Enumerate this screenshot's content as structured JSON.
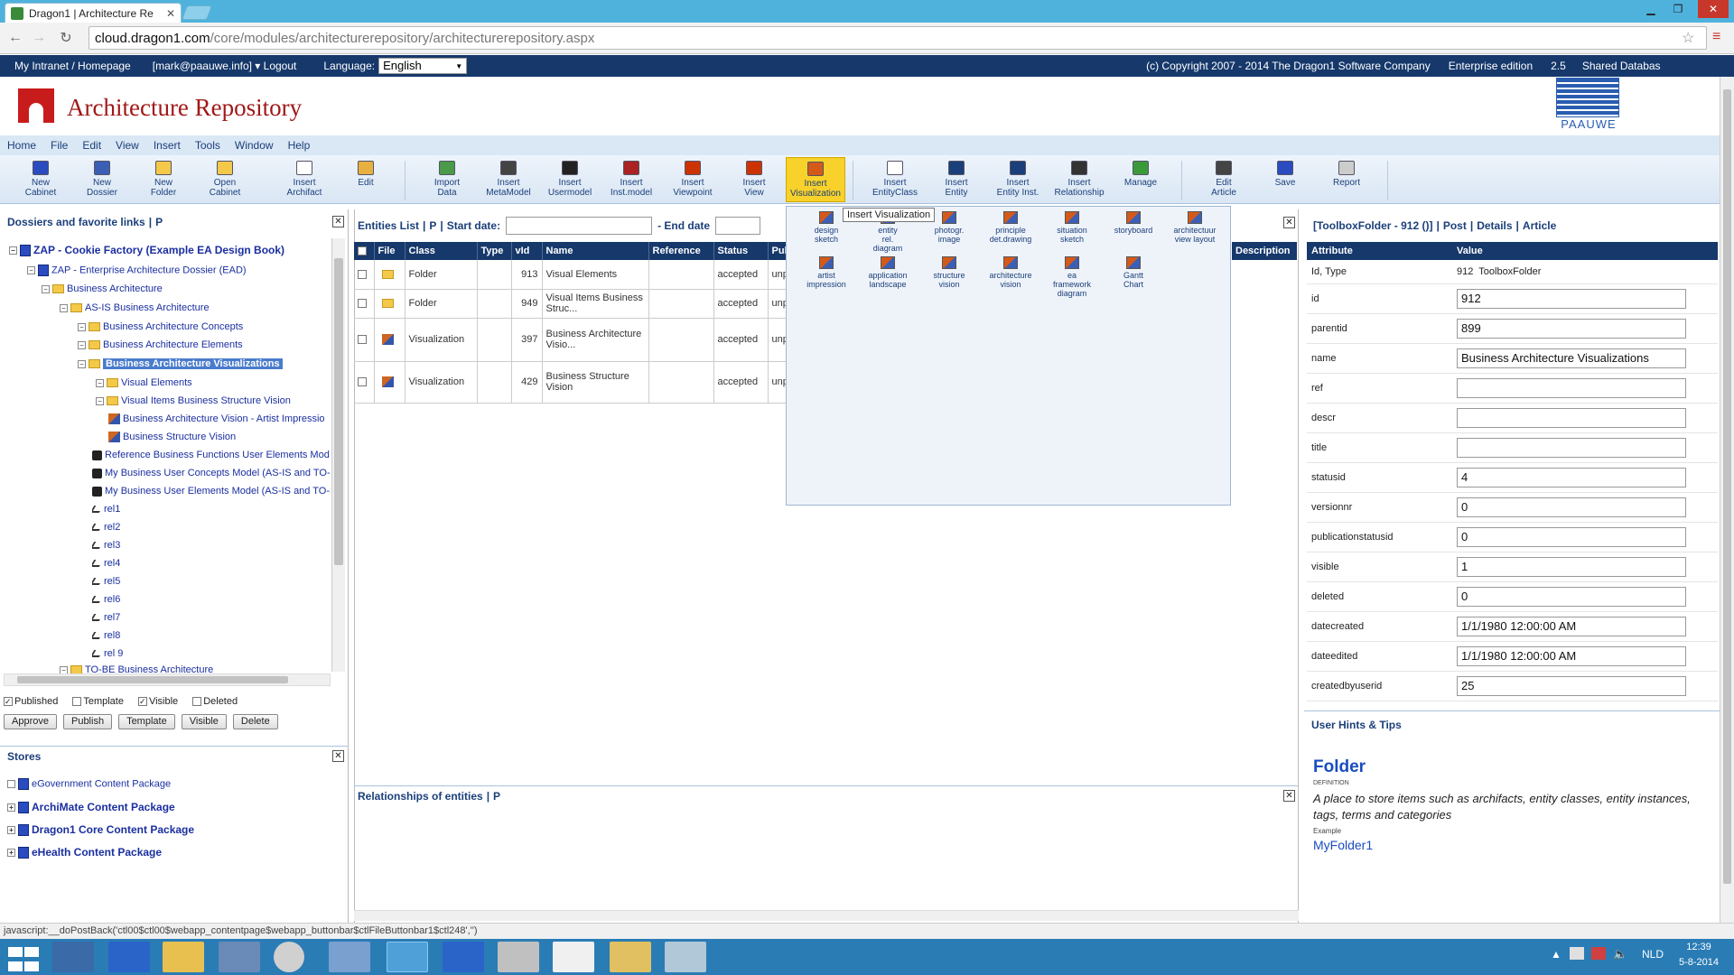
{
  "browser": {
    "tab_title": "Dragon1 | Architecture Re",
    "url_host": "cloud.dragon1.com",
    "url_path": "/core/modules/architecturerepository/architecturerepository.aspx"
  },
  "topbar": {
    "home_link": "My Intranet / Homepage",
    "user": "[mark@paauwe.info] ▾ Logout",
    "language_label": "Language:",
    "language_value": "English",
    "copyright": "(c) Copyright 2007 - 2014 The Dragon1 Software Company",
    "edition": "Enterprise edition",
    "version": "2.5",
    "db": "Shared Databas"
  },
  "header": {
    "title": "Architecture Repository",
    "partner_logo": "PAAUWE"
  },
  "menu": [
    "Home",
    "File",
    "Edit",
    "View",
    "Insert",
    "Tools",
    "Window",
    "Help"
  ],
  "toolbar": [
    {
      "label": "New\nCabinet",
      "color": "#2a4cc0"
    },
    {
      "label": "New\nDossier",
      "color": "#3a5fb5"
    },
    {
      "label": "New\nFolder",
      "color": "#f4c94a"
    },
    {
      "label": "Open\nCabinet",
      "color": "#f4c94a"
    },
    {
      "label": "Insert\nArchifact",
      "color": "#ffffff"
    },
    {
      "label": "Edit",
      "color": "#e8b040"
    },
    {
      "label": "Import\nData",
      "color": "#4a9a4a"
    },
    {
      "label": "Insert\nMetaModel",
      "color": "#444444"
    },
    {
      "label": "Insert\nUsermodel",
      "color": "#222222"
    },
    {
      "label": "Insert\nInst.model",
      "color": "#aa2222"
    },
    {
      "label": "Insert\nViewpoint",
      "color": "#cc3300"
    },
    {
      "label": "Insert\nView",
      "color": "#cc3300"
    },
    {
      "label": "Insert\nVisualization",
      "color": "#d45a1a"
    },
    {
      "label": "Insert\nEntityClass",
      "color": "#ffffff"
    },
    {
      "label": "Insert\nEntity",
      "color": "#1b3f7a"
    },
    {
      "label": "Insert\nEntity Inst.",
      "color": "#1b3f7a"
    },
    {
      "label": "Insert\nRelationship",
      "color": "#333333"
    },
    {
      "label": "Manage",
      "color": "#3a9a3a"
    },
    {
      "label": "Edit\nArticle",
      "color": "#444444"
    },
    {
      "label": "Save",
      "color": "#2a4cc0"
    },
    {
      "label": "Report",
      "color": "#cccccc"
    }
  ],
  "tooltip": "Insert Visualization",
  "visualization_types": [
    "design\nsketch",
    "entity\nrel.\ndiagram",
    "photogr.\nimage",
    "principle\ndet.drawing",
    "situation\nsketch",
    "storyboard",
    "architectuur\nview layout",
    "artist\nimpression",
    "application\nlandscape",
    "structure\nvision",
    "architecture\nvision",
    "ea\nframework\ndiagram",
    "Gantt\nChart"
  ],
  "left": {
    "title": "Dossiers and favorite links",
    "title_link": "P",
    "tree": [
      "ZAP - Cookie Factory (Example EA Design Book)",
      "ZAP - Enterprise Architecture Dossier (EAD)",
      "Business Architecture",
      "AS-IS Business Architecture",
      "Business Architecture Concepts",
      "Business Architecture Elements",
      "Business Architecture Visualizations",
      "Visual Elements",
      "Visual Items Business Structure Vision",
      "Business Architecture Vision - Artist Impressio",
      "Business Structure Vision",
      "Reference Business Functions User Elements Mod",
      "My Business User Concepts Model (AS-IS and TO-",
      "My Business User Elements Model (AS-IS and TO-E",
      "rel1",
      "rel2",
      "rel3",
      "rel4",
      "rel5",
      "rel6",
      "rel7",
      "rel8",
      "rel 9",
      "TO-BE Business Architecture"
    ],
    "filters": [
      "Published",
      "Template",
      "Visible",
      "Deleted"
    ],
    "buttons": [
      "Approve",
      "Publish",
      "Template",
      "Visible",
      "Delete"
    ]
  },
  "stores": {
    "title": "Stores",
    "items": [
      "eGovernment Content Package",
      "ArchiMate Content Package",
      "Dragon1 Core Content Package",
      "eHealth Content Package"
    ]
  },
  "entities": {
    "title": "Entities List",
    "title_link": "P",
    "start_label": "Start date:",
    "end_label": "- End date",
    "columns": [
      "File",
      "Class",
      "Type",
      "vId",
      "Name",
      "Reference",
      "Status",
      "Publ",
      "Description"
    ],
    "rows": [
      {
        "class": "Folder",
        "vid": "913",
        "name": "Visual Elements",
        "status": "accepted",
        "pub": "unp"
      },
      {
        "class": "Folder",
        "vid": "949",
        "name": "Visual Items Business Struc...",
        "status": "accepted",
        "pub": "unp"
      },
      {
        "class": "Visualization",
        "vid": "397",
        "name": "Business Architecture Visio...",
        "status": "accepted",
        "pub": "unp"
      },
      {
        "class": "Visualization",
        "vid": "429",
        "name": "Business Structure Vision",
        "status": "accepted",
        "pub": "unp"
      }
    ]
  },
  "relationships": {
    "title": "Relationships of entities",
    "title_link": "P"
  },
  "details": {
    "header_prefix": "[ToolboxFolder - 912 ()]",
    "links": [
      "Post",
      "Details",
      "Article"
    ],
    "col_attr": "Attribute",
    "col_value": "Value",
    "idtype_label": "Id, Type",
    "idtype_value": "912  ToolboxFolder",
    "rows": [
      {
        "k": "id",
        "v": "912"
      },
      {
        "k": "parentid",
        "v": "899"
      },
      {
        "k": "name",
        "v": "Business Architecture Visualizations"
      },
      {
        "k": "ref",
        "v": ""
      },
      {
        "k": "descr",
        "v": ""
      },
      {
        "k": "title",
        "v": ""
      },
      {
        "k": "statusid",
        "v": "4"
      },
      {
        "k": "versionnr",
        "v": "0"
      },
      {
        "k": "publicationstatusid",
        "v": "0"
      },
      {
        "k": "visible",
        "v": "1"
      },
      {
        "k": "deleted",
        "v": "0"
      },
      {
        "k": "datecreated",
        "v": "1/1/1980 12:00:00 AM"
      },
      {
        "k": "dateedited",
        "v": "1/1/1980 12:00:00 AM"
      },
      {
        "k": "createdbyuserid",
        "v": "25"
      }
    ]
  },
  "hints": {
    "title": "User Hints & Tips",
    "term": "Folder",
    "definition_label": "DEFINITION",
    "definition": "A place to store items such as archifacts, entity classes, entity instances, tags, terms and categories",
    "example_label": "Example",
    "example": "MyFolder1"
  },
  "statusbar": "javascript:__doPostBack('ctl00$ctl00$webapp_contentpage$webapp_buttonbar$ctlFileButtonbar1$ctl248','')",
  "taskbar": {
    "lang": "NLD",
    "time": "12:39",
    "date": "5-8-2014"
  }
}
